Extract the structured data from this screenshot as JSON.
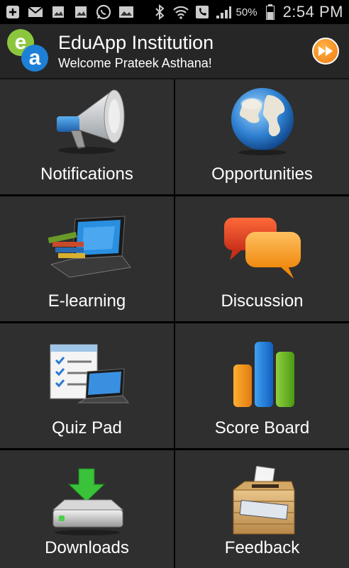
{
  "status_bar": {
    "battery_percent": "50%",
    "time": "2:54 PM",
    "icons": [
      "plus-icon",
      "mail-icon",
      "gallery-icon",
      "gallery-icon",
      "whatsapp-icon",
      "image-icon",
      "bluetooth-icon",
      "wifi-icon",
      "phone-icon",
      "signal-icon",
      "battery-icon"
    ]
  },
  "header": {
    "logo_letters": {
      "first": "e",
      "second": "a"
    },
    "title": "EduApp Institution",
    "subtitle": "Welcome Prateek Asthana!",
    "action_icon": "fast-forward-icon"
  },
  "tiles": [
    {
      "label": "Notifications",
      "icon": "megaphone-icon"
    },
    {
      "label": "Opportunities",
      "icon": "globe-icon"
    },
    {
      "label": "E-learning",
      "icon": "laptop-books-icon"
    },
    {
      "label": "Discussion",
      "icon": "chat-bubbles-icon"
    },
    {
      "label": "Quiz Pad",
      "icon": "checklist-laptop-icon"
    },
    {
      "label": "Score Board",
      "icon": "bar-chart-icon"
    },
    {
      "label": "Downloads",
      "icon": "download-drive-icon"
    },
    {
      "label": "Feedback",
      "icon": "feedback-box-icon"
    }
  ],
  "colors": {
    "header_bg": "#262626",
    "tile_bg": "#2f2f2f",
    "accent_orange": "#f07a10",
    "logo_green": "#8cc63f",
    "logo_blue": "#1e7fd6"
  }
}
